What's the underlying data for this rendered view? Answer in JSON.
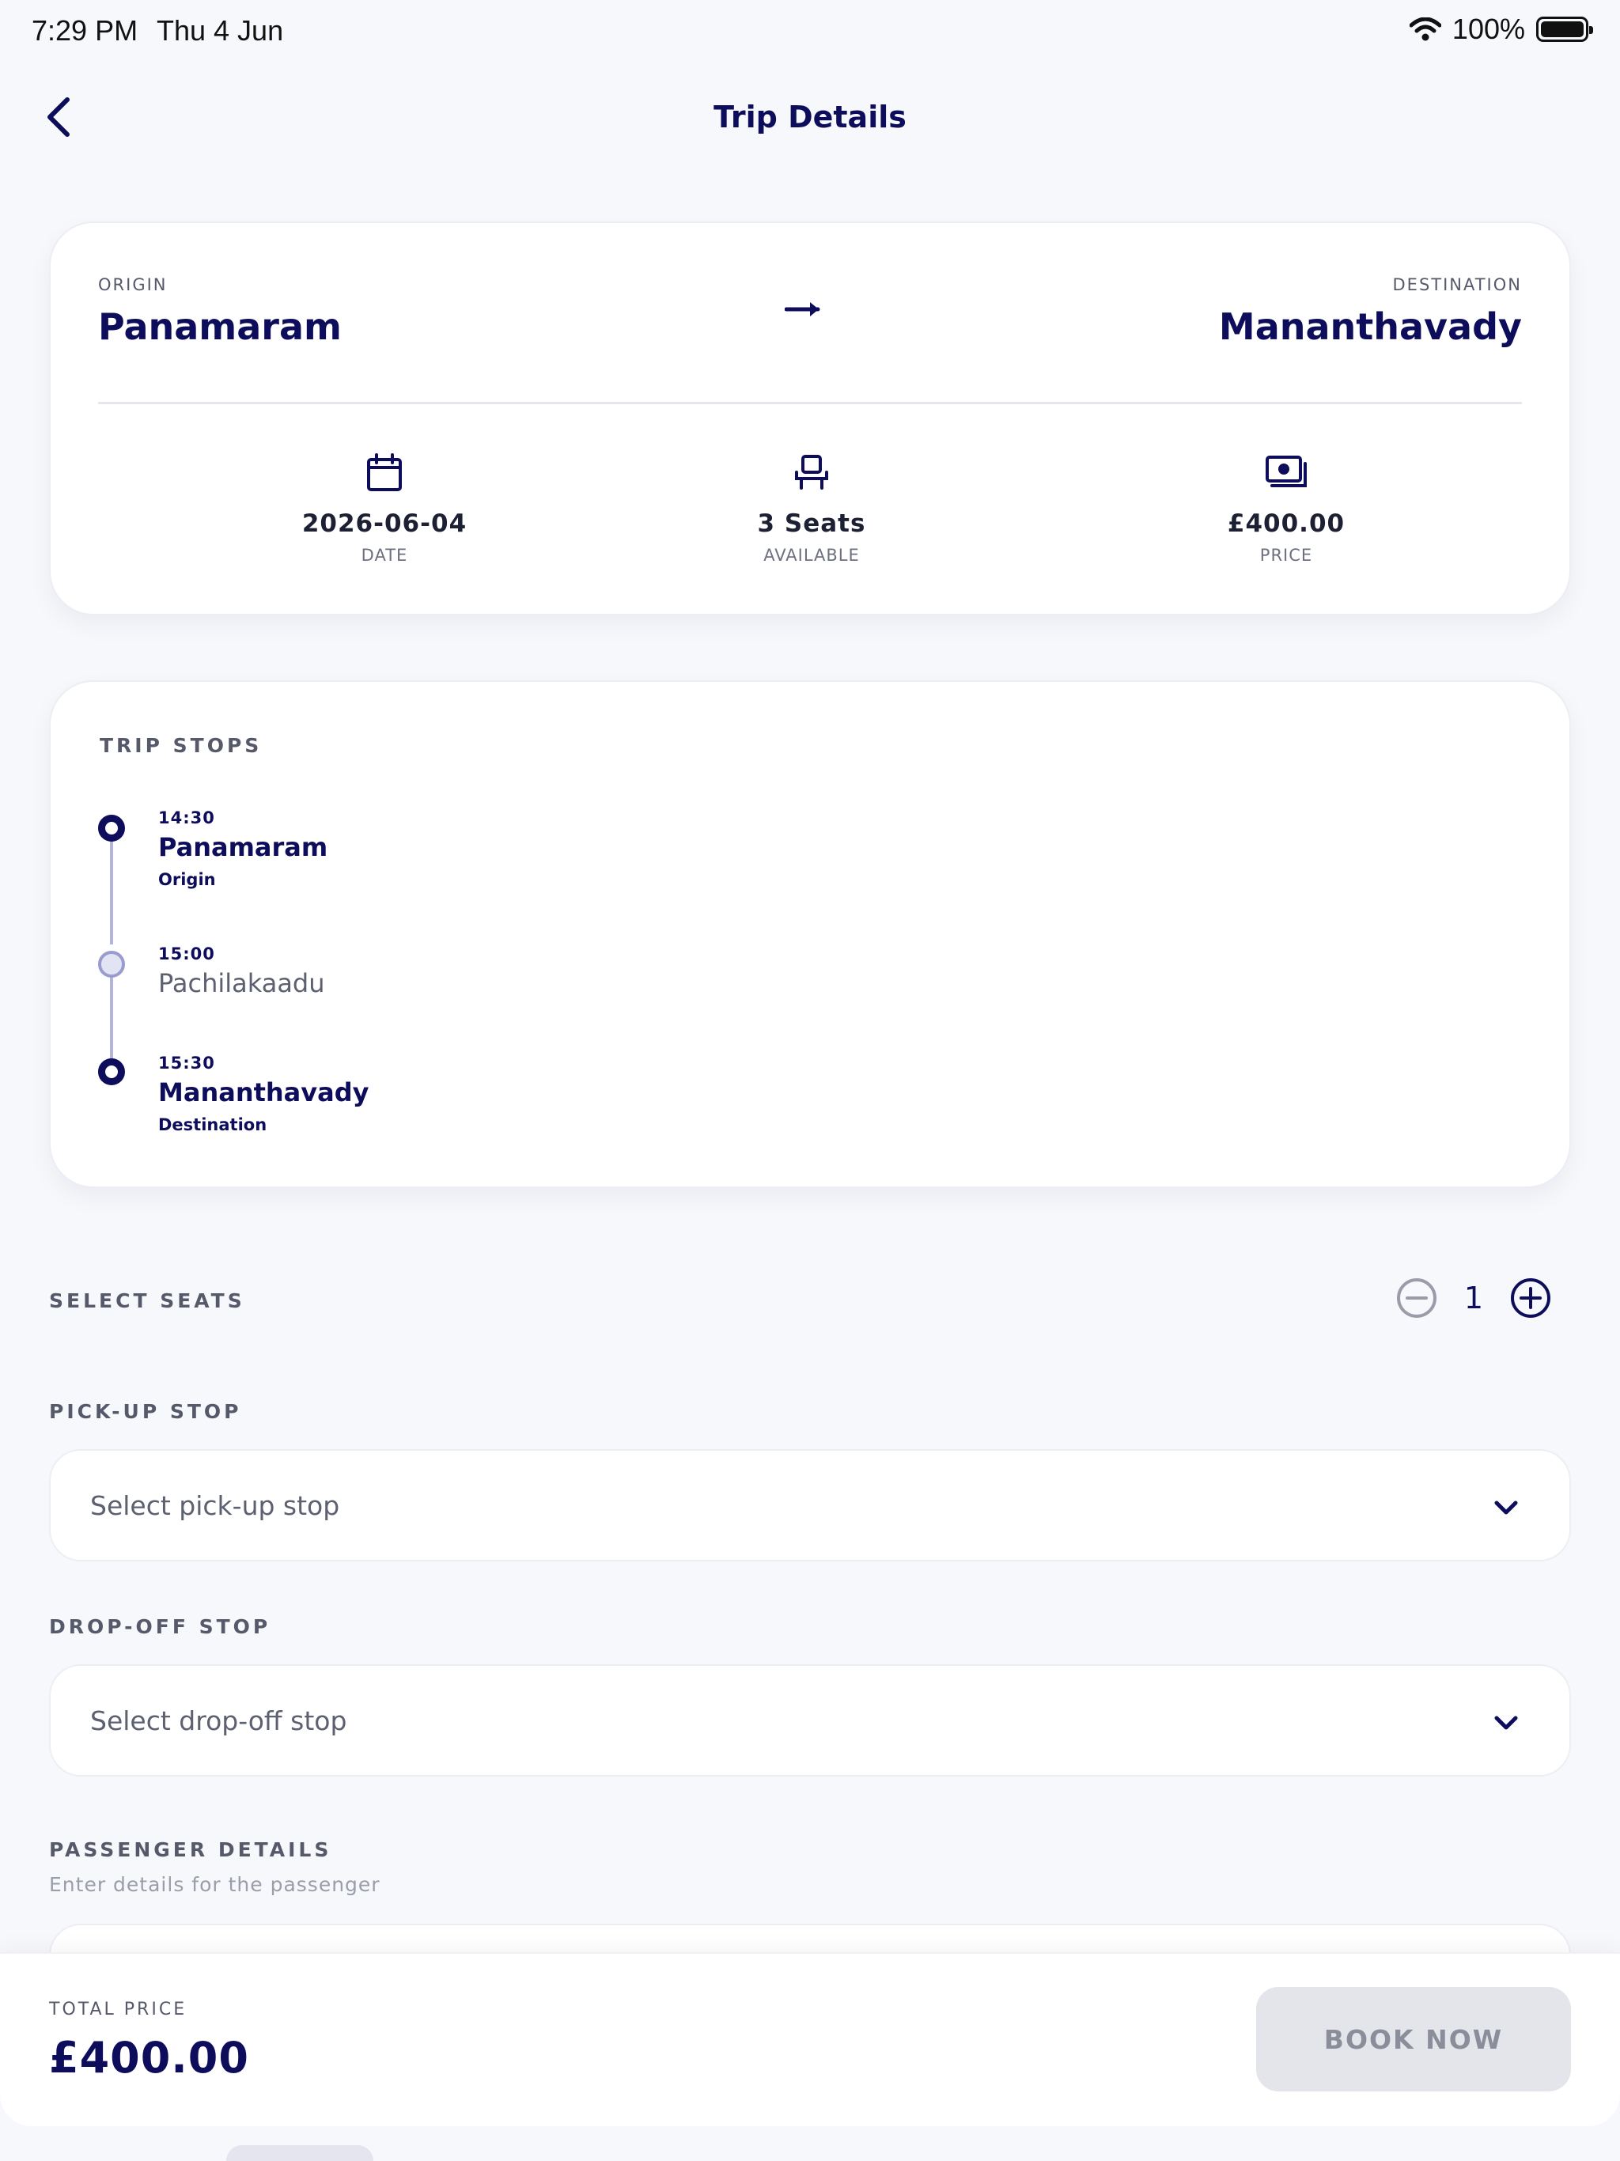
{
  "status_bar": {
    "time": "7:29 PM",
    "date": "Thu 4 Jun",
    "battery": "100%"
  },
  "nav": {
    "title": "Trip Details"
  },
  "route": {
    "origin_label": "ORIGIN",
    "origin": "Panamaram",
    "destination_label": "DESTINATION",
    "destination": "Mananthavady"
  },
  "stats": {
    "date": {
      "value": "2026-06-04",
      "caption": "DATE",
      "icon": "calendar-icon"
    },
    "seats": {
      "value": "3 Seats",
      "caption": "AVAILABLE",
      "icon": "seat-icon"
    },
    "price": {
      "value": "£400.00",
      "caption": "PRICE",
      "icon": "cash-icon"
    }
  },
  "stops": {
    "title": "TRIP STOPS",
    "items": [
      {
        "time": "14:30",
        "name": "Panamaram",
        "role": "Origin"
      },
      {
        "time": "15:00",
        "name": "Pachilakaadu",
        "role": ""
      },
      {
        "time": "15:30",
        "name": "Mananthavady",
        "role": "Destination"
      }
    ]
  },
  "seats_select": {
    "label": "SELECT SEATS",
    "value": "1"
  },
  "pickup": {
    "label": "PICK-UP STOP",
    "placeholder": "Select pick-up stop"
  },
  "dropoff": {
    "label": "DROP-OFF STOP",
    "placeholder": "Select drop-off stop"
  },
  "passenger": {
    "label": "PASSENGER DETAILS",
    "subtitle": "Enter details for the passenger"
  },
  "footer": {
    "total_label": "TOTAL PRICE",
    "total": "£400.00",
    "book_label": "BOOK NOW"
  },
  "colors": {
    "primary": "#0d0d5c",
    "background": "#f7f8fb",
    "disabled": "#e4e5ea"
  }
}
